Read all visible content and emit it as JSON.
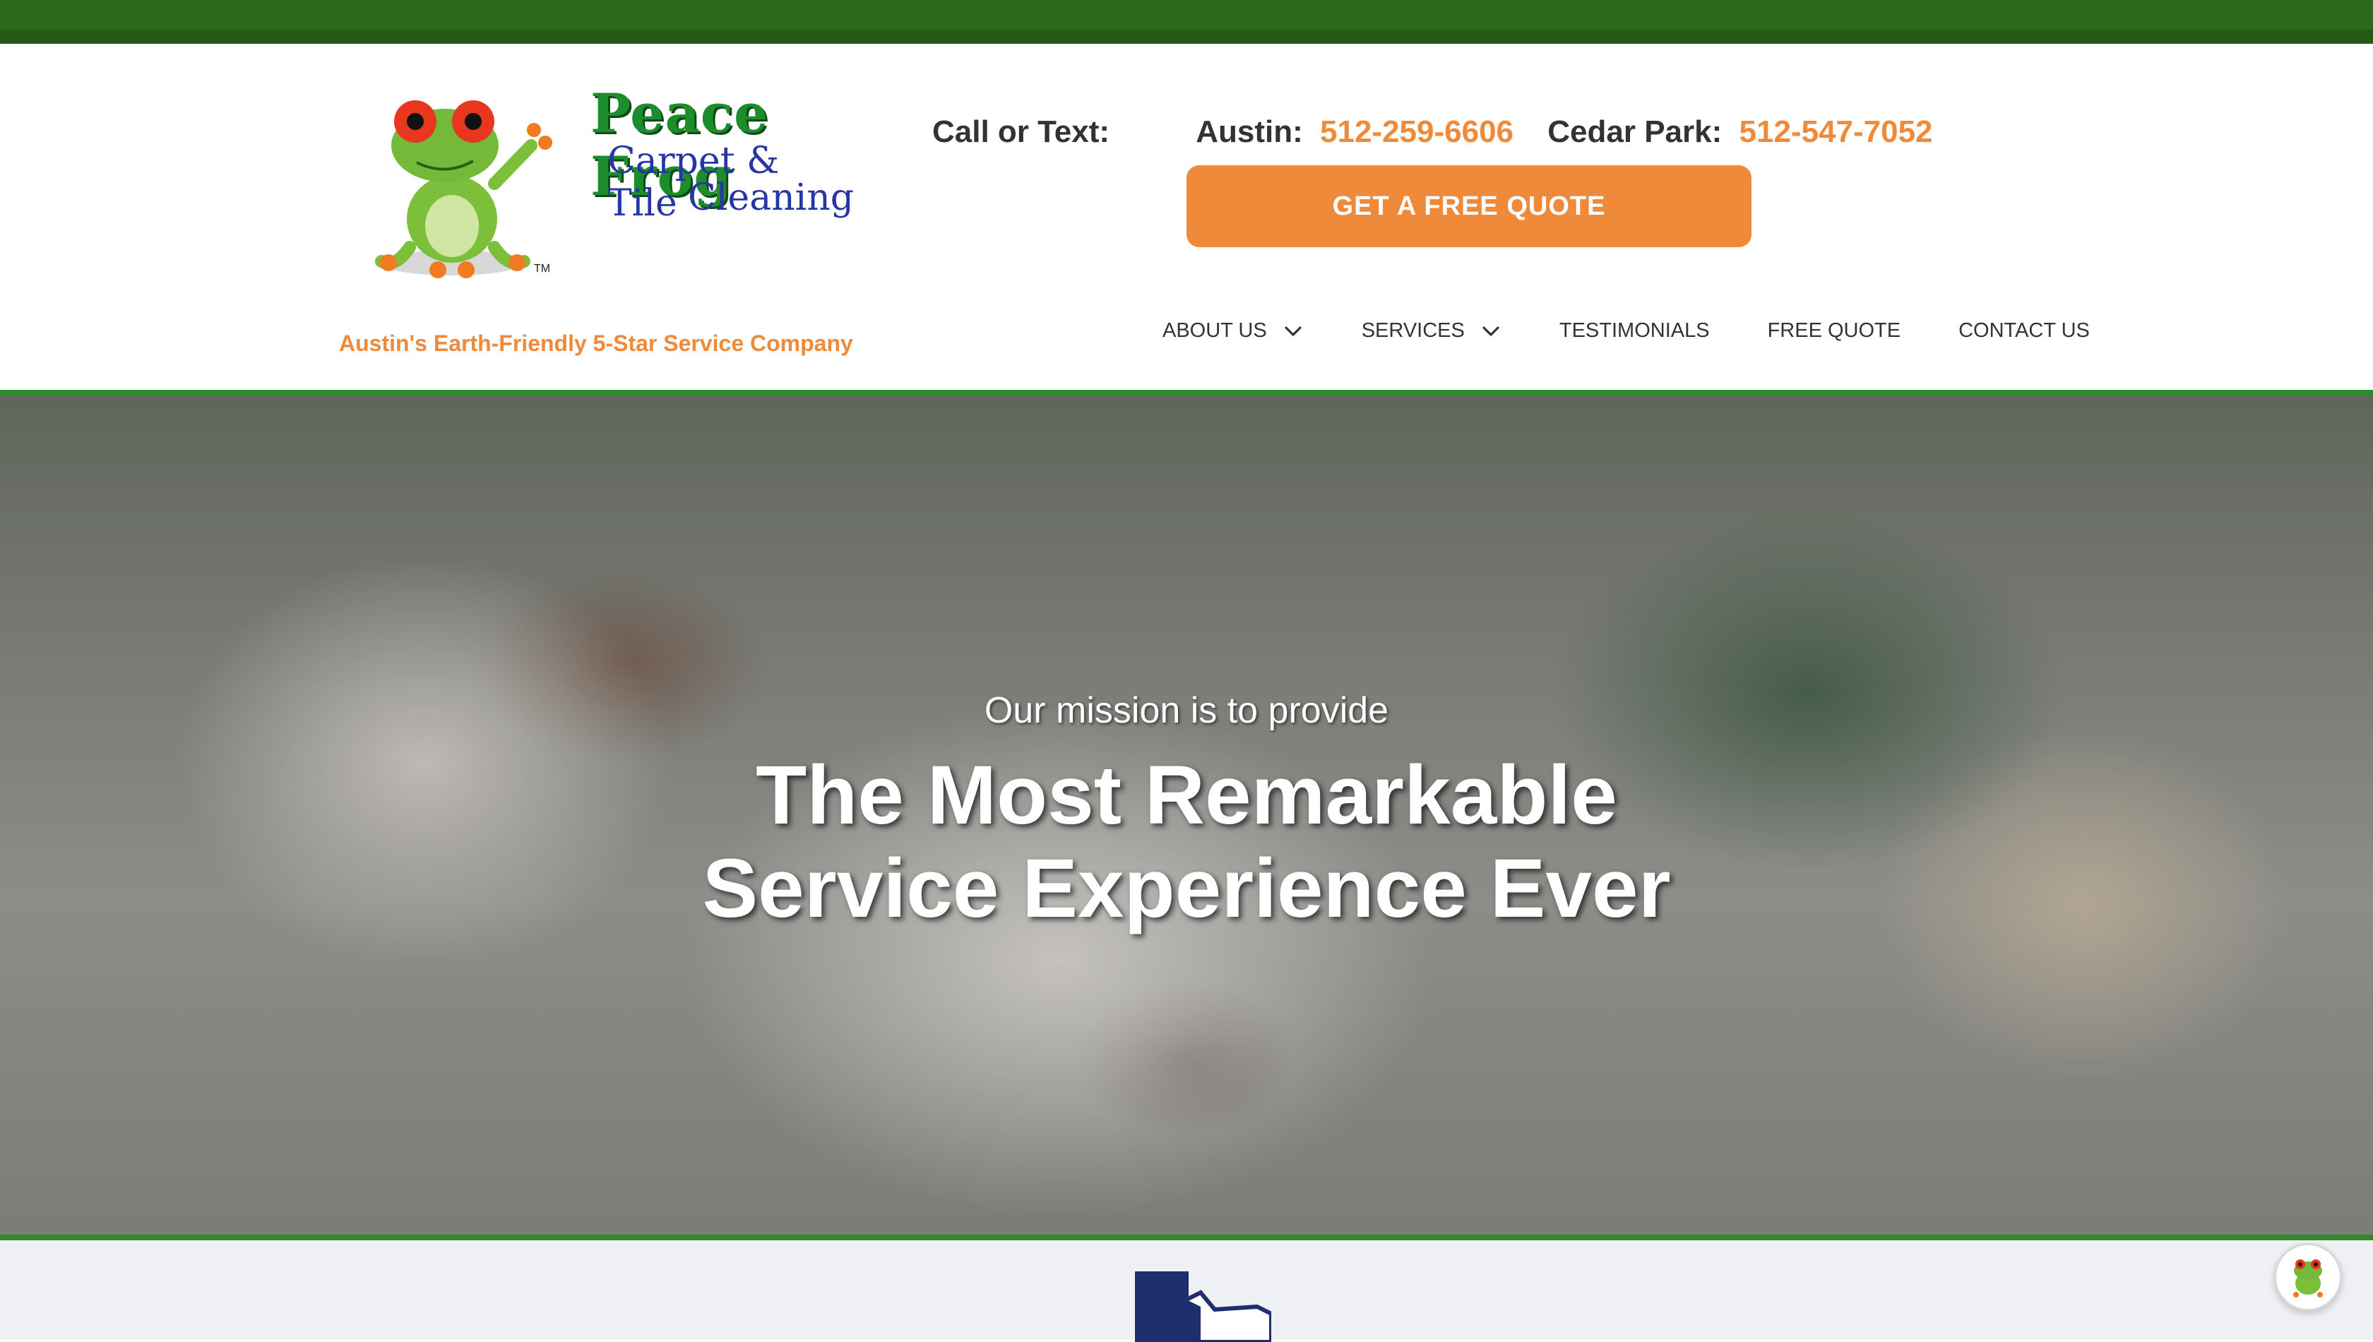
{
  "logo": {
    "title": "Peace Frog",
    "line1": "Carpet & Tile",
    "line2": "Cleaning",
    "tm": "TM"
  },
  "tagline": "Austin's Earth-Friendly 5-Star Service Company",
  "contact": {
    "call_label": "Call or Text:",
    "austin_label": "Austin:",
    "austin_phone": "512-259-6606",
    "cedar_label": "Cedar Park:",
    "cedar_phone": "512-547-7052"
  },
  "quote_button": "GET A FREE QUOTE",
  "nav": {
    "items": [
      {
        "label": "ABOUT US",
        "has_dropdown": true
      },
      {
        "label": "SERVICES",
        "has_dropdown": true
      },
      {
        "label": "TESTIMONIALS",
        "has_dropdown": false
      },
      {
        "label": "FREE QUOTE",
        "has_dropdown": false
      },
      {
        "label": "CONTACT US",
        "has_dropdown": false
      }
    ]
  },
  "hero": {
    "subtitle": "Our mission is to provide",
    "title_line1": "The Most Remarkable",
    "title_line2": "Service Experience Ever"
  },
  "icons": {
    "dropdown": "chevron-down-icon",
    "texas": "texas-map-icon",
    "chat": "frog-chat-icon"
  },
  "colors": {
    "brand_green": "#2e6a1b",
    "accent_orange": "#ef8a3a",
    "text_dark": "#333333",
    "logo_blue": "#2637a5"
  }
}
